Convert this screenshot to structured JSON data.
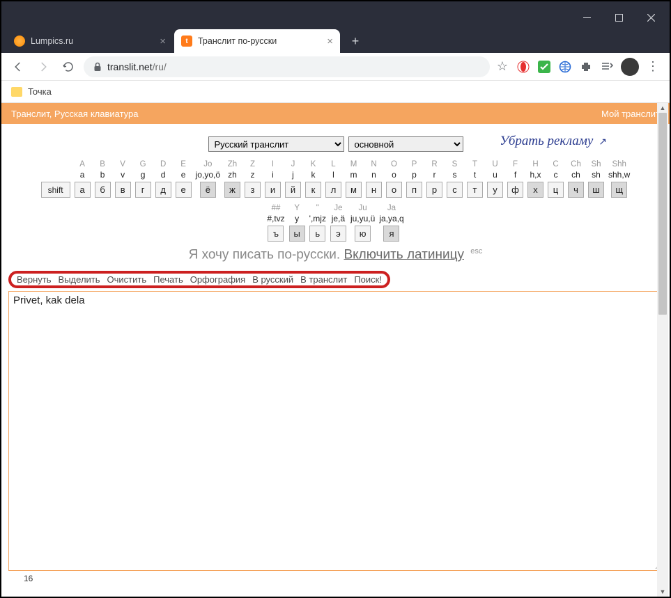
{
  "tabs": [
    {
      "title": "Lumpics.ru",
      "active": false
    },
    {
      "title": "Транслит по-русски",
      "active": true,
      "favicon": "t"
    }
  ],
  "url": {
    "host": "translit.net",
    "path": "/ru/"
  },
  "bookmarks": {
    "folder": "Точка"
  },
  "site_header": {
    "left": "Транслит, Русская клавиатура",
    "right": "Мой транслит"
  },
  "selects": {
    "scheme": "Русский транслит",
    "variant": "основной"
  },
  "handwriting": "Убрать рекламу",
  "keyboard": {
    "row1": [
      {
        "lat": "A",
        "tr": "a",
        "key": "а"
      },
      {
        "lat": "B",
        "tr": "b",
        "key": "б"
      },
      {
        "lat": "V",
        "tr": "v",
        "key": "в"
      },
      {
        "lat": "G",
        "tr": "g",
        "key": "г"
      },
      {
        "lat": "D",
        "tr": "d",
        "key": "д"
      },
      {
        "lat": "E",
        "tr": "e",
        "key": "е"
      },
      {
        "lat": "Jo",
        "tr": "jo,yo,ö",
        "key": "ё",
        "shaded": true
      },
      {
        "lat": "Zh",
        "tr": "zh",
        "key": "ж",
        "shaded": true
      },
      {
        "lat": "Z",
        "tr": "z",
        "key": "з"
      },
      {
        "lat": "I",
        "tr": "i",
        "key": "и"
      },
      {
        "lat": "J",
        "tr": "j",
        "key": "й"
      },
      {
        "lat": "K",
        "tr": "k",
        "key": "к"
      },
      {
        "lat": "L",
        "tr": "l",
        "key": "л"
      },
      {
        "lat": "M",
        "tr": "m",
        "key": "м"
      },
      {
        "lat": "N",
        "tr": "n",
        "key": "н"
      },
      {
        "lat": "O",
        "tr": "o",
        "key": "о"
      },
      {
        "lat": "P",
        "tr": "p",
        "key": "п"
      },
      {
        "lat": "R",
        "tr": "r",
        "key": "р"
      },
      {
        "lat": "S",
        "tr": "s",
        "key": "с"
      },
      {
        "lat": "T",
        "tr": "t",
        "key": "т"
      },
      {
        "lat": "U",
        "tr": "u",
        "key": "у"
      },
      {
        "lat": "F",
        "tr": "f",
        "key": "ф"
      },
      {
        "lat": "H",
        "tr": "h,x",
        "key": "х",
        "shaded": true
      },
      {
        "lat": "C",
        "tr": "c",
        "key": "ц"
      },
      {
        "lat": "Ch",
        "tr": "ch",
        "key": "ч",
        "shaded": true
      },
      {
        "lat": "Sh",
        "tr": "sh",
        "key": "ш",
        "shaded": true
      },
      {
        "lat": "Shh",
        "tr": "shh,w",
        "key": "щ",
        "shaded": true
      }
    ],
    "shift": "shift",
    "row2": [
      {
        "lat": "##",
        "tr": "#,tvz",
        "key": "ъ"
      },
      {
        "lat": "Y",
        "tr": "y",
        "key": "ы",
        "shaded": true
      },
      {
        "lat": "''",
        "tr": "',mjz",
        "key": "ь"
      },
      {
        "lat": "Je",
        "tr": "je,ä",
        "key": "э"
      },
      {
        "lat": "Ju",
        "tr": "ju,yu,ü",
        "key": "ю"
      },
      {
        "lat": "Ja",
        "tr": "ja,ya,q",
        "key": "я",
        "shaded": true
      }
    ]
  },
  "prompt": {
    "text": "Я хочу писать по-русски.",
    "link": "Включить латиницу",
    "esc": "esc"
  },
  "actions": [
    "Вернуть",
    "Выделить",
    "Очистить",
    "Печать",
    "Орфография",
    "В русский",
    "В транслит",
    "Поиск!"
  ],
  "textarea": "Privet, kak dela",
  "char_count": "16"
}
